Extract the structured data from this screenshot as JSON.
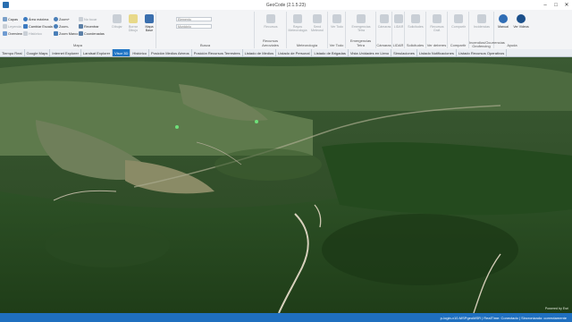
{
  "window": {
    "title": "GeoCode (2.1.5.23)"
  },
  "ribbon": {
    "mapa": {
      "label": "Mapa",
      "capas": "Capas",
      "leyenda": "Leyenda",
      "overview": "Overview",
      "area_maxima": "Área máxima",
      "cambiar_escala": "Cambiar Escala",
      "historico": "Histórico",
      "zoom_plus": "Zoom+",
      "zoom_minus": "Zoom-",
      "zoom_marco": "Zoom Marco",
      "no_tocar": "No tocar",
      "recentrar": "Recentrar",
      "coordenadas": "Coordenadas",
      "dibujar": "Dibujar",
      "borrar_dibujo": "Borrar Dibujo",
      "mapa_base": "Mapa Base"
    },
    "busca": {
      "label": "Busca",
      "field1_placeholder": "Elemento",
      "field2_placeholder": "Municipio"
    },
    "large": {
      "recursos": "Recursos",
      "rayos_meteo": "Rayos Meteorología",
      "send_meteo": "Send Meteorol",
      "ver_todo": "Ver Todo",
      "em_tetra": "Emergencias Tetra",
      "camaras": "Cámaras",
      "lidar": "LIDAR",
      "solicitudes": "Solicitudes",
      "recursos_graf": "Recursos Gráf.",
      "compartir": "Compartir",
      "incidencias": "Incidencias",
      "manual": "Manual",
      "ver_videos": "Ver Videos"
    },
    "group_labels": {
      "recursos_aeroviales": "Recursos Aeroviales",
      "meteorologia": "Meteorología",
      "ver_todo": "Ver Todo",
      "emergencias_tetra": "Emergencias Tetra",
      "camaras": "Cámaras",
      "lidar": "LIDAR",
      "solicitudes": "Solicitudes",
      "ver_deberes": "Ver deberes",
      "compartir": "Compartir",
      "incendios_geoprocesos": "Incendios/Ocurrencias Geofencing",
      "ayuda": "Ayuda"
    }
  },
  "tabs": [
    "Tiempo Real",
    "Google Maps",
    "Internet Explorer",
    "Landsat Explorer",
    "Visor 3D",
    "Histórico",
    "Posición Medios Aéreos",
    "Posición Recursos Terrestres",
    "Listado de Medios",
    "Listado de Personal",
    "Listado de Brigadas",
    "Vista Unidades en Lleno",
    "Simulaciones",
    "Listado Notificaciones",
    "Listado Recursos Operativos"
  ],
  "active_tab": "Visor 3D",
  "map": {
    "attribution": "Powered by Esri"
  },
  "status": {
    "text": "p-login-v10-MSPgeoMSR | RealTime: Conectado | Sincronizado: correctamente"
  },
  "colors": {
    "accent": "#1f74c4",
    "status_bar": "#1f6fbf"
  }
}
